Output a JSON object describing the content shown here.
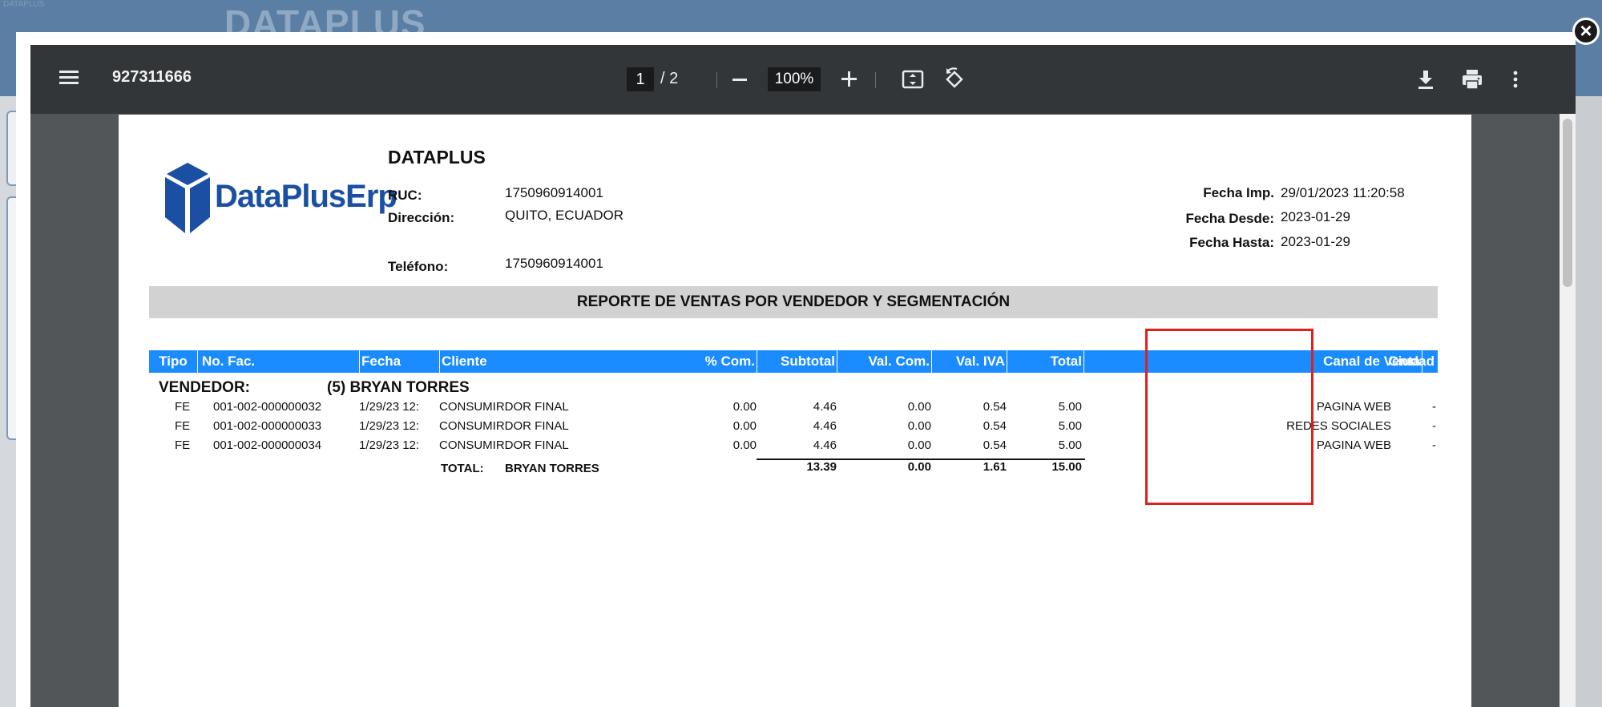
{
  "background": {
    "brand": "DATAPLUS",
    "tiny_text": "DATAPLUS"
  },
  "viewer": {
    "file_title": "927311666",
    "current_page": "1",
    "page_separator": "/ 2",
    "zoom": "100%",
    "icons": [
      "menu-icon",
      "zoom-out-icon",
      "zoom-in-icon",
      "fit-page-icon",
      "rotate-icon",
      "download-icon",
      "print-icon",
      "more-icon",
      "close-icon"
    ]
  },
  "report": {
    "company": "DATAPLUS",
    "logo_text": "DataPlusErp",
    "ruc_label": "RUC:",
    "ruc_value": "1750960914001",
    "direccion_label": "Dirección:",
    "direccion_value": "QUITO, ECUADOR",
    "telefono_label": "Teléfono:",
    "telefono_value": "1750960914001",
    "fecha_imp_label": "Fecha Imp.",
    "fecha_imp_value": "29/01/2023 11:20:58",
    "fecha_desde_label": "Fecha Desde:",
    "fecha_desde_value": "2023-01-29",
    "fecha_hasta_label": "Fecha Hasta:",
    "fecha_hasta_value": "2023-01-29",
    "title": "REPORTE DE VENTAS POR VENDEDOR Y SEGMENTACIÓN",
    "columns": {
      "tipo": "Tipo",
      "nofac": "No. Fac.",
      "fecha": "Fecha",
      "cliente": "Cliente",
      "com": "% Com.",
      "subtotal": "Subtotal",
      "valcom": "Val. Com.",
      "valiva": "Val. IVA",
      "total": "Total",
      "canal": "Canal de Venta",
      "ciudad": "Ciudad"
    },
    "vendedor_label": "VENDEDOR:",
    "vendedor_name": "(5) BRYAN TORRES",
    "rows": [
      {
        "tipo": "FE",
        "nofac": "001-002-000000032",
        "fecha": "1/29/23 12:",
        "cliente": "CONSUMIRDOR FINAL",
        "com": "0.00",
        "subtotal": "4.46",
        "valcom": "0.00",
        "valiva": "0.54",
        "total": "5.00",
        "canal": "PAGINA WEB",
        "ciudad": "-"
      },
      {
        "tipo": "FE",
        "nofac": "001-002-000000033",
        "fecha": "1/29/23 12:",
        "cliente": "CONSUMIRDOR FINAL",
        "com": "0.00",
        "subtotal": "4.46",
        "valcom": "0.00",
        "valiva": "0.54",
        "total": "5.00",
        "canal": "REDES SOCIALES",
        "ciudad": "-"
      },
      {
        "tipo": "FE",
        "nofac": "001-002-000000034",
        "fecha": "1/29/23 12:",
        "cliente": "CONSUMIRDOR FINAL",
        "com": "0.00",
        "subtotal": "4.46",
        "valcom": "0.00",
        "valiva": "0.54",
        "total": "5.00",
        "canal": "PAGINA WEB",
        "ciudad": "-"
      }
    ],
    "total_label": "TOTAL:",
    "total_name": "BRYAN TORRES",
    "totals": {
      "subtotal": "13.39",
      "valcom": "0.00",
      "valiva": "1.61",
      "total": "15.00"
    }
  },
  "colors": {
    "table_header": "#1a8cff",
    "highlight": "#e0201d",
    "toolbar": "#323639",
    "logo": "#1a4fa3"
  }
}
